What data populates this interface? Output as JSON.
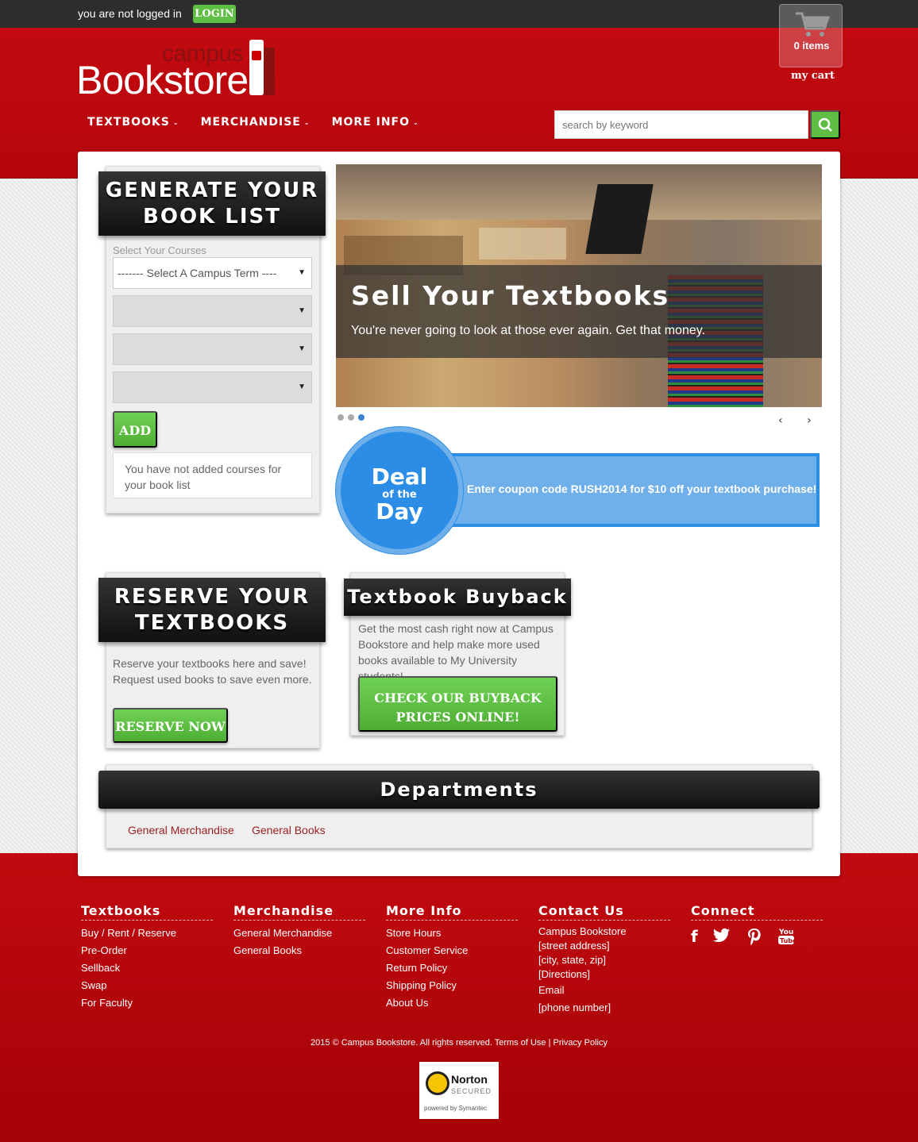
{
  "topbar": {
    "status": "you are not logged in",
    "login_label": "LOGIN"
  },
  "logo": {
    "campus": "campus",
    "bookstore": "Bookstore"
  },
  "cart": {
    "count": "0 items",
    "label": "my cart"
  },
  "nav": [
    {
      "label": "TEXTBOOKS"
    },
    {
      "label": "MERCHANDISE"
    },
    {
      "label": "MORE INFO"
    }
  ],
  "search": {
    "placeholder": "search by keyword"
  },
  "book_list": {
    "title_line1": "GENERATE YOUR",
    "title_line2": "BOOK LIST",
    "select_label": "Select Your Courses",
    "term_select": "------- Select A Campus Term ----",
    "add_label": "ADD",
    "notice": "You have not added courses for your book list"
  },
  "slider": {
    "title": "Sell Your Textbooks",
    "text": "You're never going to look at those ever again. Get that money.",
    "prev": "‹",
    "next": "›"
  },
  "deal": {
    "line1": "Deal",
    "line2": "of the",
    "line3": "Day",
    "text": "Enter coupon code RUSH2014 for $10 off your textbook purchase!"
  },
  "reserve": {
    "title_line1": "RESERVE YOUR",
    "title_line2": "TEXTBOOKS",
    "text": "Reserve your textbooks here and save! Request used books to save even more.",
    "button": "RESERVE NOW"
  },
  "buyback": {
    "title": "Textbook Buyback",
    "text": "Get the most cash right now at Campus Bookstore and help make more used books available to My University students!",
    "button_line1": "CHECK OUR BUYBACK",
    "button_line2": "PRICES ONLINE!"
  },
  "departments": {
    "title": "Departments",
    "links": [
      "General Merchandise",
      "General Books"
    ]
  },
  "footer": {
    "textbooks": {
      "heading": "Textbooks",
      "links": [
        "Buy / Rent / Reserve",
        "Pre-Order",
        "Sellback",
        "Swap",
        "For Faculty"
      ]
    },
    "merchandise": {
      "heading": "Merchandise",
      "links": [
        "General Merchandise",
        "General Books"
      ]
    },
    "more_info": {
      "heading": "More Info",
      "links": [
        "Store Hours",
        "Customer Service",
        "Return Policy",
        "Shipping Policy",
        "About Us"
      ]
    },
    "contact": {
      "heading": "Contact Us",
      "lines": [
        "Campus Bookstore",
        "[street address]",
        "[city, state, zip]",
        "[Directions]"
      ],
      "email": "Email",
      "phone": "[phone number]"
    },
    "connect": {
      "heading": "Connect",
      "icons": [
        "facebook-icon",
        "twitter-icon",
        "pinterest-icon",
        "youtube-icon"
      ]
    },
    "copyright": "2015 © Campus Bookstore. All rights reserved. Terms of Use | Privacy Policy"
  },
  "norton": {
    "name": "Norton",
    "secured": "SECURED",
    "powered": "powered by Symantec"
  },
  "colors": {
    "red": "#c20a10",
    "green": "#5fbf45",
    "blue": "#2b8de6",
    "dark": "#1a1a1a"
  }
}
